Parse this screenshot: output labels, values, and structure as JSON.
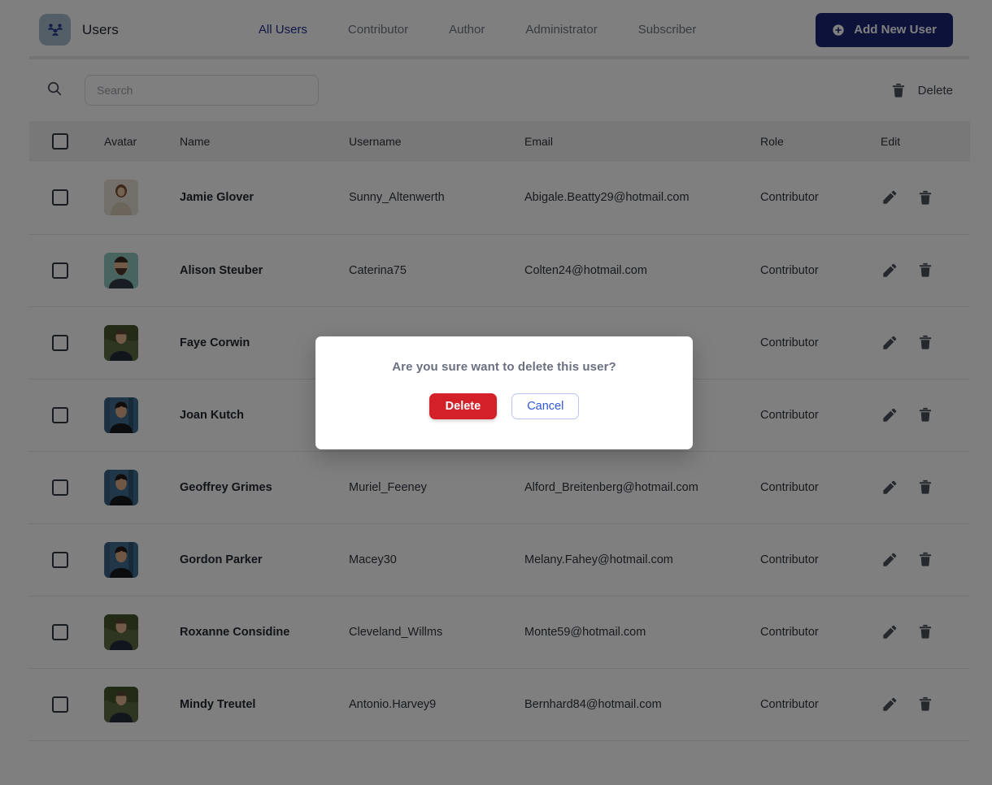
{
  "header": {
    "brand_title": "Users",
    "logo_icon": "users-group-icon",
    "tabs": [
      {
        "label": "All Users",
        "active": true
      },
      {
        "label": "Contributor",
        "active": false
      },
      {
        "label": "Author",
        "active": false
      },
      {
        "label": "Administrator",
        "active": false
      },
      {
        "label": "Subscriber",
        "active": false
      }
    ],
    "add_button": {
      "label": "Add New User",
      "icon": "plus-circle-icon"
    },
    "accent_color": "#1b2576",
    "active_tab_color": "#1f2f8f"
  },
  "toolbar": {
    "search_icon": "search-icon",
    "search_value": "",
    "search_placeholder": "Search",
    "delete_label": "Delete",
    "delete_icon": "trash-icon"
  },
  "table": {
    "columns": [
      "",
      "Avatar",
      "Name",
      "Username",
      "Email",
      "Role",
      "Edit"
    ],
    "select_all_checked": false,
    "rows": [
      {
        "checked": false,
        "avatar": "woman-brown-hair-photo",
        "name": "Jamie Glover",
        "username": "Sunny_Altenwerth",
        "email": "Abigale.Beatty29@hotmail.com",
        "role": "Contributor"
      },
      {
        "checked": false,
        "avatar": "man-beard-teal-bg-photo",
        "name": "Alison Steuber",
        "username": "Caterina75",
        "email": "Colten24@hotmail.com",
        "role": "Contributor"
      },
      {
        "checked": false,
        "avatar": "man-green-foliage-photo",
        "name": "Faye Corwin",
        "username": "",
        "email": "",
        "role": "Contributor"
      },
      {
        "checked": false,
        "avatar": "young-man-blue-bg-photo",
        "name": "Joan Kutch",
        "username": "",
        "email": "",
        "role": "Contributor"
      },
      {
        "checked": false,
        "avatar": "young-man-blue-bg-photo",
        "name": "Geoffrey Grimes",
        "username": "Muriel_Feeney",
        "email": "Alford_Breitenberg@hotmail.com",
        "role": "Contributor"
      },
      {
        "checked": false,
        "avatar": "young-man-blue-bg-photo",
        "name": "Gordon Parker",
        "username": "Macey30",
        "email": "Melany.Fahey@hotmail.com",
        "role": "Contributor"
      },
      {
        "checked": false,
        "avatar": "man-green-foliage-photo",
        "name": "Roxanne Considine",
        "username": "Cleveland_Willms",
        "email": "Monte59@hotmail.com",
        "role": "Contributor"
      },
      {
        "checked": false,
        "avatar": "man-green-foliage-photo",
        "name": "Mindy Treutel",
        "username": "Antonio.Harvey9",
        "email": "Bernhard84@hotmail.com",
        "role": "Contributor"
      }
    ],
    "row_edit_icon": "pencil-icon",
    "row_delete_icon": "trash-icon"
  },
  "modal": {
    "message": "Are you sure want to delete this user?",
    "confirm_label": "Delete",
    "cancel_label": "Cancel",
    "confirm_color": "#d32029",
    "cancel_color": "#2f56d8"
  }
}
